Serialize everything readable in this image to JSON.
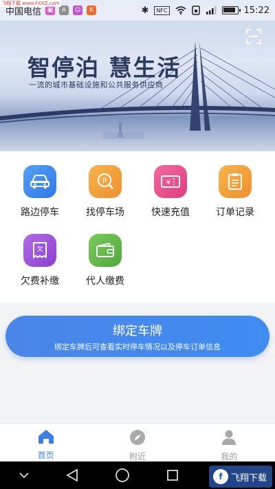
{
  "status_bar": {
    "carrier": "中国电信",
    "time": "15:22",
    "nfc": "NFC",
    "top_watermark": "飞翔下载 www.FXXZ.com"
  },
  "banner": {
    "title": "智停泊 慧生活",
    "subtitle": "一流的城市基础设施和公共服务供应商",
    "scan_icon": "scan-icon"
  },
  "menu": {
    "items": [
      {
        "label": "路边停车",
        "icon": "car-icon",
        "color": "#3d8cf0"
      },
      {
        "label": "找停车场",
        "icon": "parking-icon",
        "color": "#f0a23a"
      },
      {
        "label": "快速充值",
        "icon": "recharge-icon",
        "color": "#e84d8c"
      },
      {
        "label": "订单记录",
        "icon": "order-icon",
        "color": "#f0a23a"
      },
      {
        "label": "欠费补缴",
        "icon": "arrears-icon",
        "color": "#9b4fd6"
      },
      {
        "label": "代人缴费",
        "icon": "wallet-icon",
        "color": "#63b84d"
      }
    ]
  },
  "bind_plate": {
    "title": "绑定车牌",
    "subtitle": "绑定车牌后可查看实时停车情况以及停车订单信息"
  },
  "tabs": [
    {
      "label": "首页",
      "icon": "home-icon",
      "active": true
    },
    {
      "label": "附近",
      "icon": "compass-icon",
      "active": false
    },
    {
      "label": "我的",
      "icon": "user-icon",
      "active": false
    }
  ],
  "watermark": {
    "text": "飞翔下载",
    "logo": "f"
  },
  "colors": {
    "accent": "#3b7ee8",
    "tab_inactive": "#999999"
  }
}
